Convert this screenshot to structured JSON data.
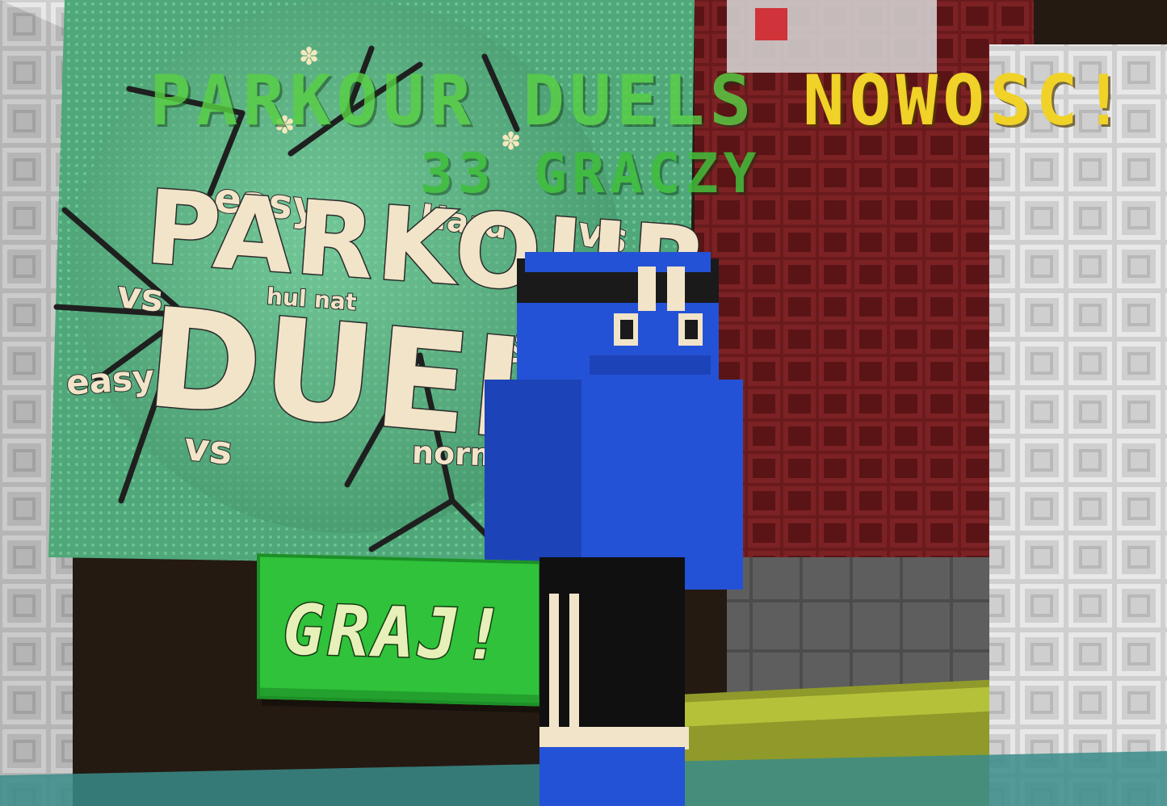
{
  "hologram": {
    "title_main": "PARKOUR DUELS",
    "title_tag": "NOWOSC!",
    "players": "33 GRACZY"
  },
  "poster": {
    "title_line1": "PARKOUR",
    "title_line2": "DUELS",
    "words": [
      "easy",
      "Hard",
      "vs",
      "vs",
      "hul nat",
      "vs",
      "easy",
      "vs",
      "norm"
    ]
  },
  "play_button": {
    "label": "GRAJ!"
  },
  "colors": {
    "hologram_green": "#58d044",
    "hologram_yellow": "#f0d228",
    "button_green": "#2fc23a",
    "skin_blue": "#2452d6"
  }
}
